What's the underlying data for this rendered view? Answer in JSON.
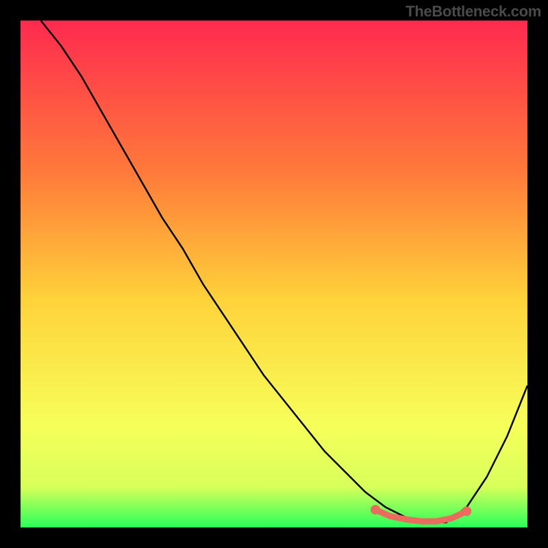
{
  "attribution": "TheBottleneck.com",
  "colors": {
    "background": "#000000",
    "gradient_top": "#ff2a4f",
    "gradient_mid_upper": "#ff7a3a",
    "gradient_mid": "#ffd23a",
    "gradient_mid_lower": "#f6ff5a",
    "gradient_lower": "#d8ff5a",
    "gradient_bottom": "#2aff5a",
    "curve": "#000000",
    "marker_stroke": "#ec6a5e",
    "marker_fill": "#ec6a5e"
  },
  "chart_data": {
    "type": "line",
    "title": "",
    "xlabel": "",
    "ylabel": "",
    "xlim": [
      0,
      100
    ],
    "ylim": [
      0,
      100
    ],
    "series": [
      {
        "name": "bottleneck-curve",
        "x": [
          4,
          8,
          12,
          16,
          20,
          24,
          28,
          32,
          36,
          40,
          44,
          48,
          52,
          56,
          60,
          64,
          68,
          72,
          76,
          80,
          84,
          88,
          92,
          96,
          100
        ],
        "y": [
          100,
          95,
          89,
          82,
          75,
          68,
          61,
          55,
          48,
          42,
          36,
          30,
          25,
          20,
          15,
          11,
          7,
          4,
          2,
          1,
          1,
          4,
          10,
          18,
          28
        ]
      }
    ],
    "highlight": {
      "name": "optimal-range",
      "x": [
        70,
        73,
        76,
        79,
        82,
        85,
        88
      ],
      "y": [
        3.5,
        2.2,
        1.6,
        1.2,
        1.2,
        1.8,
        3.2
      ]
    }
  }
}
